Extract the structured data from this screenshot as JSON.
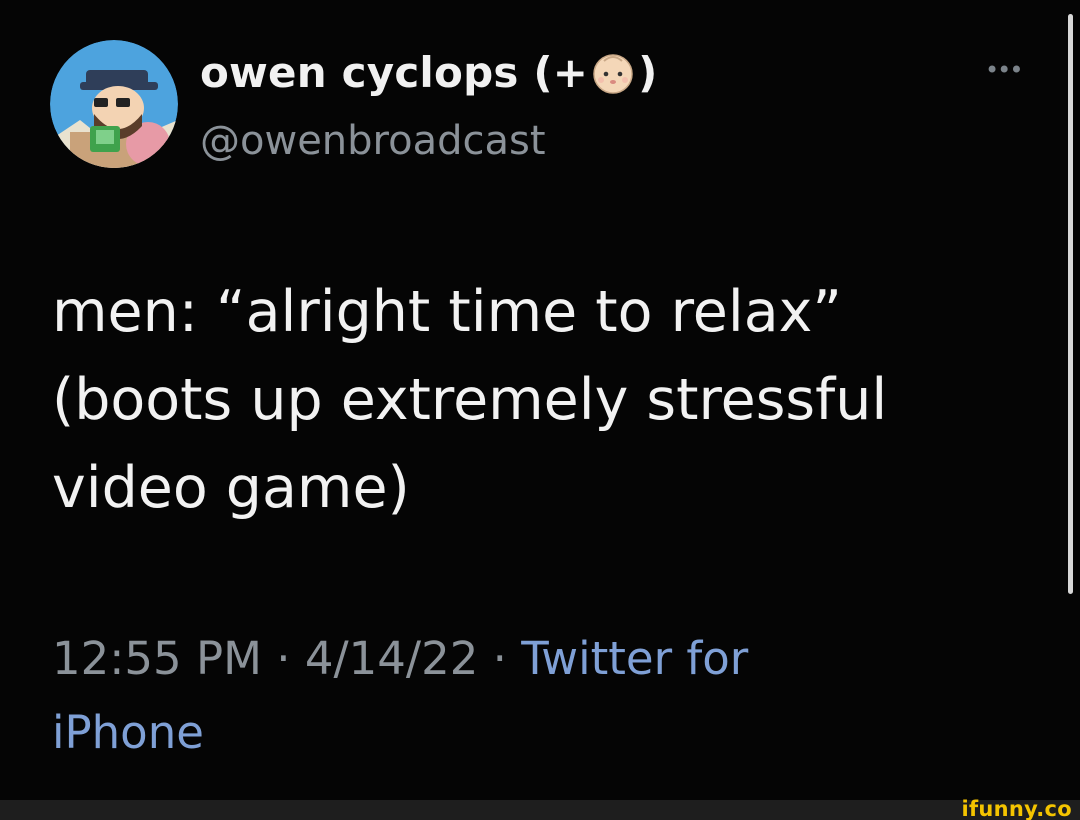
{
  "tweet": {
    "display_name_prefix": "owen cyclops (+",
    "display_name_suffix": ")",
    "display_name_emoji": "baby-face",
    "handle": "@owenbroadcast",
    "more_label": "•••",
    "text_lines": [
      "men: “alright time to relax”",
      "(boots up extremely stressful",
      "video game)"
    ],
    "timestamp": "12:55 PM · 4/14/22 · ",
    "source_line1": "Twitter for",
    "source_line2": "iPhone"
  },
  "watermark": "ifunny.co",
  "colors": {
    "background": "#050505",
    "text": "#f2f2f2",
    "muted": "#8b9299",
    "link": "#7fa0d6",
    "watermark": "#f5c400"
  }
}
